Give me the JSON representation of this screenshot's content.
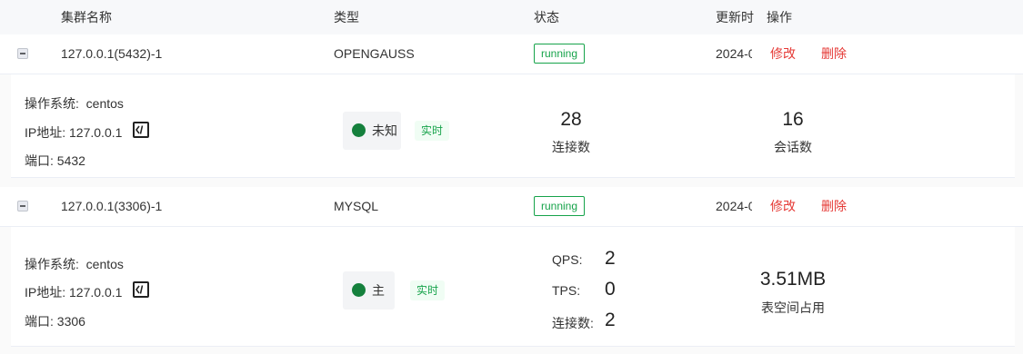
{
  "table": {
    "columns": {
      "name": "集群名称",
      "type": "类型",
      "status": "状态",
      "updated": "更新时",
      "actions": "操作"
    }
  },
  "rows": [
    {
      "name": "127.0.0.1(5432)-1",
      "type": "OPENGAUSS",
      "status": "running",
      "updated": "2024-0",
      "edit": "修改",
      "delete": "删除",
      "detail": {
        "os_label": "操作系统:",
        "os_value": "centos",
        "ip_label": "IP地址:",
        "ip_value": "127.0.0.1",
        "port_label": "端口:",
        "port_value": "5432",
        "role": "未知",
        "realtime": "实时",
        "metric1_value": "28",
        "metric1_label": "连接数",
        "metric2_value": "16",
        "metric2_label": "会话数"
      }
    },
    {
      "name": "127.0.0.1(3306)-1",
      "type": "MYSQL",
      "status": "running",
      "updated": "2024-0",
      "edit": "修改",
      "delete": "删除",
      "detail": {
        "os_label": "操作系统:",
        "os_value": "centos",
        "ip_label": "IP地址:",
        "ip_value": "127.0.0.1",
        "port_label": "端口:",
        "port_value": "3306",
        "role": "主",
        "realtime": "实时",
        "qps_label": "QPS:",
        "qps_value": "2",
        "tps_label": "TPS:",
        "tps_value": "0",
        "conn_label": "连接数:",
        "conn_value": "2",
        "space_value": "3.51MB",
        "space_label": "表空间占用"
      }
    }
  ],
  "colors": {
    "running": "#16a34a",
    "action_link": "#e53935",
    "status_dot": "#15803d"
  },
  "icons": {
    "expand_toggle": "minus-square-icon",
    "code": "code-icon"
  }
}
